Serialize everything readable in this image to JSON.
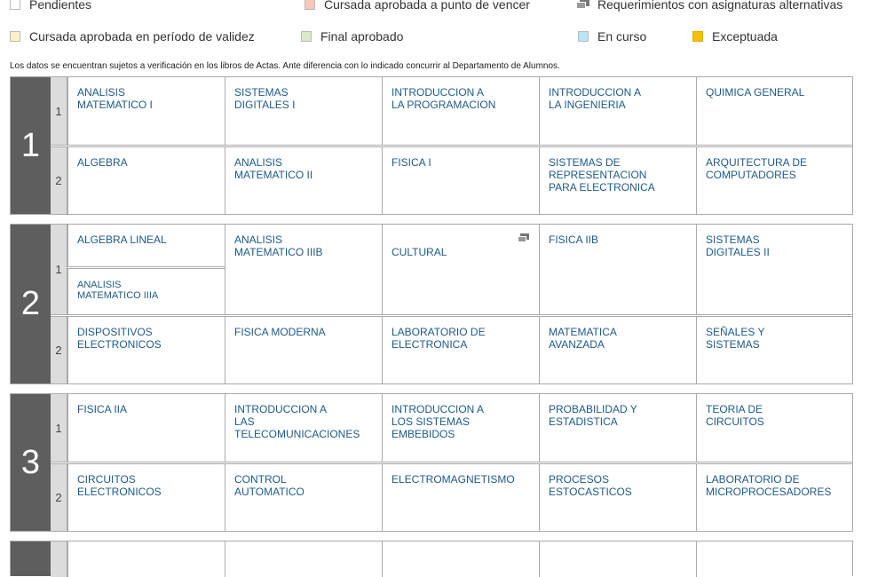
{
  "legend": {
    "pendientes": {
      "label": "Pendientes",
      "color": "#ffffff"
    },
    "por_vencer": {
      "label": "Cursada aprobada a punto de vencer",
      "color": "#f7c7b8"
    },
    "alternativas": {
      "label": "Requerimientos con asignaturas alternativas"
    },
    "vigente": {
      "label": "Cursada aprobada en período de validez",
      "color": "#fdf0c8"
    },
    "final": {
      "label": "Final aprobado",
      "color": "#dde8c6"
    },
    "en_curso": {
      "label": "En curso",
      "color": "#b8e6f5"
    },
    "exceptuada": {
      "label": "Exceptuada",
      "color": "#f5c000"
    }
  },
  "notice": "Los datos se encuentran sujetos a verificación en los libros de Actas. Ante diferencia con lo indicado concurrir al Departamento de Alumnos.",
  "years": [
    {
      "number": "1",
      "semesters": [
        {
          "label": "1",
          "subjects": [
            "ANALISIS\nMATEMATICO I",
            "SISTEMAS\nDIGITALES I",
            "INTRODUCCION A\nLA PROGRAMACION",
            "INTRODUCCION A\nLA INGENIERIA",
            "QUIMICA GENERAL"
          ]
        },
        {
          "label": "2",
          "subjects": [
            "ALGEBRA",
            "ANALISIS\nMATEMATICO II",
            "FISICA I",
            "SISTEMAS DE\nREPRESENTACION\nPARA ELECTRONICA",
            "ARQUITECTURA DE\nCOMPUTADORES"
          ]
        }
      ]
    },
    {
      "number": "2",
      "semesters": [
        {
          "label": "1",
          "subjects": [
            "ALGEBRA LINEAL",
            "ANALISIS\nMATEMATICO IIIB",
            "CULTURAL",
            "FISICA IIB",
            "SISTEMAS\nDIGITALES II"
          ],
          "extra": "ANALISIS\nMATEMATICO IIIA"
        },
        {
          "label": "2",
          "subjects": [
            "DISPOSITIVOS\nELECTRONICOS",
            "FISICA MODERNA",
            "LABORATORIO DE\nELECTRONICA",
            "MATEMATICA\nAVANZADA",
            "SEÑALES Y\nSISTEMAS"
          ]
        }
      ]
    },
    {
      "number": "3",
      "semesters": [
        {
          "label": "1",
          "subjects": [
            "FISICA IIA",
            "INTRODUCCION A\nLAS\nTELECOMUNICACIONES",
            "INTRODUCCION A\nLOS SISTEMAS\nEMBEBIDOS",
            "PROBABILIDAD Y\nESTADISTICA",
            "TEORIA DE\nCIRCUITOS"
          ]
        },
        {
          "label": "2",
          "subjects": [
            "CIRCUITOS\nELECTRONICOS",
            "CONTROL\nAUTOMATICO",
            "ELECTROMAGNETISMO",
            "PROCESOS\nESTOCASTICOS",
            "LABORATORIO DE\nMICROPROCESADORES"
          ]
        }
      ]
    }
  ]
}
